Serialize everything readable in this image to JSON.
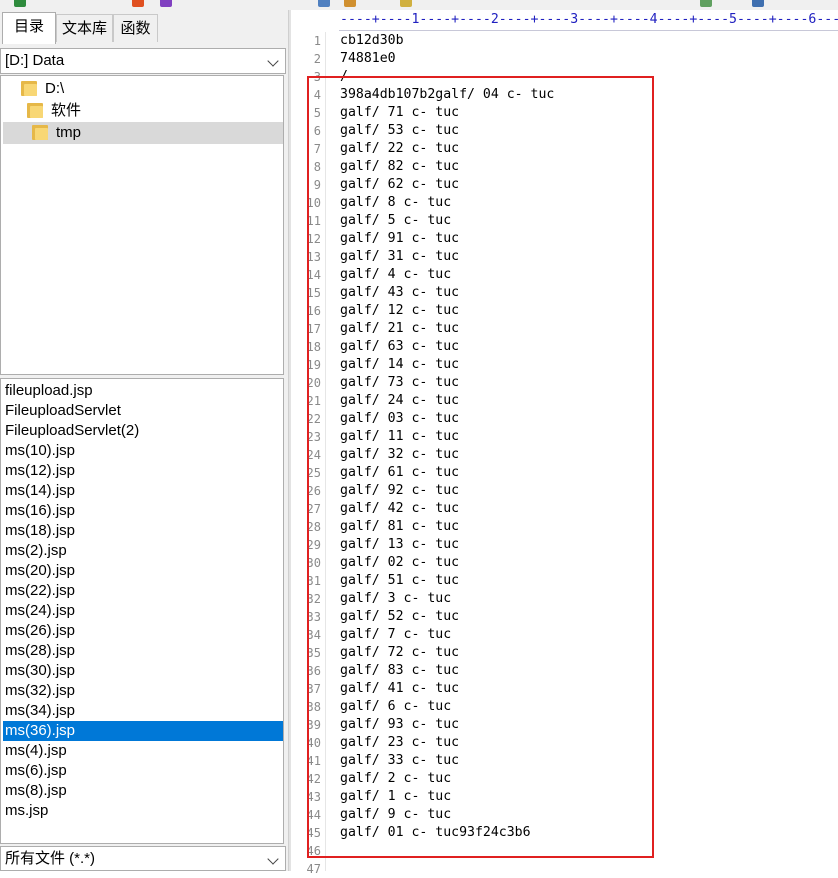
{
  "left_panel": {
    "tabs": [
      {
        "label": "目录",
        "active": true
      },
      {
        "label": "文本库",
        "active": false
      },
      {
        "label": "函数",
        "active": false
      }
    ],
    "drive_select": {
      "value": "[D:] Data"
    },
    "tree": [
      {
        "label": "D:\\",
        "level": 0,
        "selected": false
      },
      {
        "label": "软件",
        "level": 1,
        "selected": false
      },
      {
        "label": "tmp",
        "level": 1,
        "selected": true
      }
    ],
    "files": [
      "fileupload.jsp",
      "FileuploadServlet",
      "FileuploadServlet(2)",
      "ms(10).jsp",
      "ms(12).jsp",
      "ms(14).jsp",
      "ms(16).jsp",
      "ms(18).jsp",
      "ms(2).jsp",
      "ms(20).jsp",
      "ms(22).jsp",
      "ms(24).jsp",
      "ms(26).jsp",
      "ms(28).jsp",
      "ms(30).jsp",
      "ms(32).jsp",
      "ms(34).jsp",
      "ms(36).jsp",
      "ms(4).jsp",
      "ms(6).jsp",
      "ms(8).jsp",
      "ms.jsp"
    ],
    "selected_file": "ms(36).jsp",
    "filter_select": {
      "value": "所有文件 (*.*)"
    }
  },
  "editor": {
    "ruler": "----+----1----+----2----+----3----+----4----+----5----+----6---",
    "line_numbers": [
      "1",
      "2",
      "3",
      "4",
      "5",
      "6",
      "7",
      "8",
      "9",
      "10",
      "11",
      "12",
      "13",
      "14",
      "15",
      "16",
      "17",
      "18",
      "19",
      "20",
      "21",
      "22",
      "23",
      "24",
      "25",
      "26",
      "27",
      "28",
      "29",
      "30",
      "31",
      "32",
      "33",
      "34",
      "35",
      "36",
      "37",
      "38",
      "39",
      "40",
      "41",
      "42",
      "43",
      "44",
      "45",
      "46",
      "47"
    ],
    "lines": [
      "cb12d30b",
      "74881e0",
      "/",
      "398a4db107b2galf/ 04 c- tuc",
      "galf/ 71 c- tuc",
      "galf/ 53 c- tuc",
      "galf/ 22 c- tuc",
      "galf/ 82 c- tuc",
      "galf/ 62 c- tuc",
      "galf/ 8 c- tuc",
      "galf/ 5 c- tuc",
      "galf/ 91 c- tuc",
      "galf/ 31 c- tuc",
      "galf/ 4 c- tuc",
      "galf/ 43 c- tuc",
      "galf/ 12 c- tuc",
      "galf/ 21 c- tuc",
      "galf/ 63 c- tuc",
      "galf/ 14 c- tuc",
      "galf/ 73 c- tuc",
      "galf/ 24 c- tuc",
      "galf/ 03 c- tuc",
      "galf/ 11 c- tuc",
      "galf/ 32 c- tuc",
      "galf/ 61 c- tuc",
      "galf/ 92 c- tuc",
      "galf/ 42 c- tuc",
      "galf/ 81 c- tuc",
      "galf/ 13 c- tuc",
      "galf/ 02 c- tuc",
      "galf/ 51 c- tuc",
      "galf/ 3 c- tuc",
      "galf/ 52 c- tuc",
      "galf/ 7 c- tuc",
      "galf/ 72 c- tuc",
      "galf/ 83 c- tuc",
      "galf/ 41 c- tuc",
      "galf/ 6 c- tuc",
      "galf/ 93 c- tuc",
      "galf/ 23 c- tuc",
      "galf/ 33 c- tuc",
      "galf/ 2 c- tuc",
      "galf/ 1 c- tuc",
      "galf/ 9 c- tuc",
      "galf/ 01 c- tuc93f24c3b6",
      "",
      ""
    ]
  },
  "colors": {
    "selection": "#0078d7",
    "highlight_box": "#e02020",
    "ruler_text": "#2020c0",
    "folder": "#f8d775"
  },
  "icons": {
    "tree_item": "folder-icon",
    "dropdown": "chevron-down-icon"
  }
}
